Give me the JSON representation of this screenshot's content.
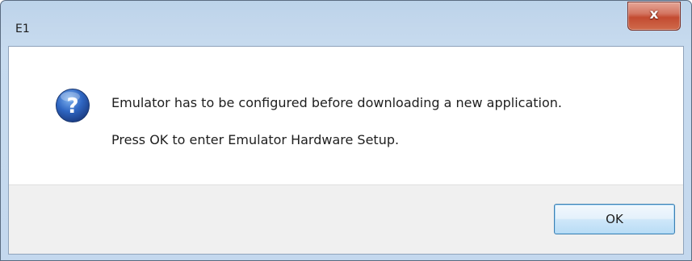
{
  "window": {
    "title": "E1",
    "close_glyph": "x",
    "close_icon": "close-icon"
  },
  "dialog": {
    "icon": "question-icon",
    "message_line1": "Emulator has to be configured before downloading a new application.",
    "message_line2": "Press OK to enter Emulator Hardware Setup.",
    "ok_label": "OK"
  },
  "colors": {
    "frame": "#c4d8ee",
    "close_button": "#c75539",
    "ok_border": "#3c7fb1",
    "button_bar": "#f0f0f0",
    "icon_blue": "#2a5db0"
  }
}
